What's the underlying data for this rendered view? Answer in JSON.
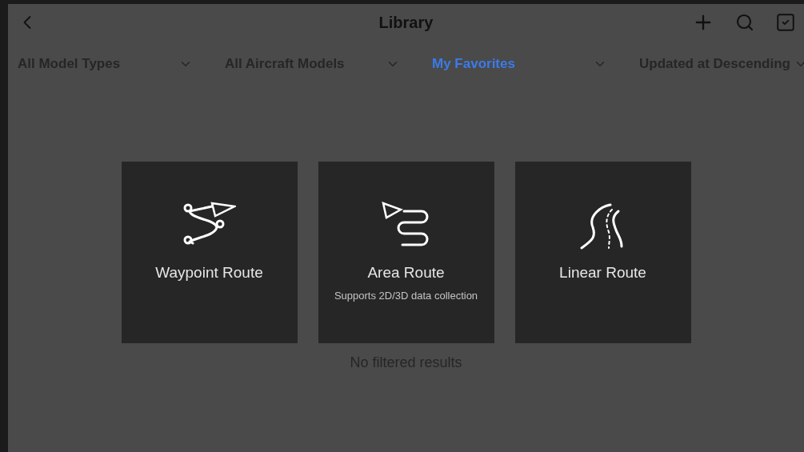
{
  "header": {
    "title": "Library"
  },
  "filters": [
    {
      "label": "All Model Types",
      "selected": false
    },
    {
      "label": "All Aircraft Models",
      "selected": false
    },
    {
      "label": "My Favorites",
      "selected": true
    },
    {
      "label": "Updated at Descending",
      "selected": false
    }
  ],
  "route_types": [
    {
      "kind": "waypoint",
      "label": "Waypoint Route"
    },
    {
      "kind": "area",
      "label": "Area Route",
      "subtitle": "Supports 2D/3D data collection"
    },
    {
      "kind": "linear",
      "label": "Linear Route"
    }
  ],
  "empty_message": "No filtered results"
}
